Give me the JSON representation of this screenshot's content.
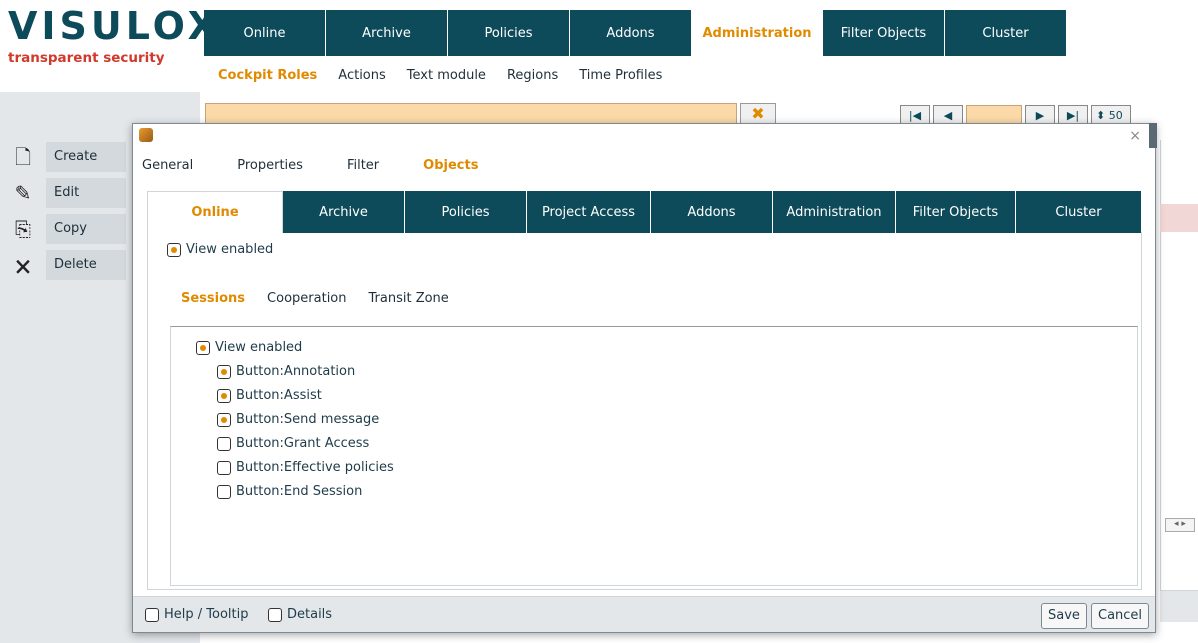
{
  "app": {
    "logo_main": "VISULOX",
    "logo_sub": "transparent security"
  },
  "topnav": [
    "Online",
    "Archive",
    "Policies",
    "Addons",
    "Administration",
    "Filter Objects",
    "Cluster"
  ],
  "topnav_active": "Administration",
  "subnav": [
    "Cockpit Roles",
    "Actions",
    "Text module",
    "Regions",
    "Time Profiles"
  ],
  "subnav_active": "Cockpit Roles",
  "pager": {
    "page_size": "50"
  },
  "side_actions": [
    {
      "label": "Create",
      "icon": "new-document-icon"
    },
    {
      "label": "Edit",
      "icon": "edit-document-icon"
    },
    {
      "label": "Copy",
      "icon": "copy-document-icon"
    },
    {
      "label": "Delete",
      "icon": "delete-document-icon"
    }
  ],
  "dialog": {
    "close_glyph": "×",
    "tabs": [
      "General",
      "Properties",
      "Filter",
      "Objects"
    ],
    "tabs_active": "Objects",
    "object_tabs": [
      "Online",
      "Archive",
      "Policies",
      "Project Access",
      "Addons",
      "Administration",
      "Filter Objects",
      "Cluster"
    ],
    "object_tabs_active": "Online",
    "view_enabled": {
      "label": "View enabled",
      "checked": true
    },
    "subtabs": [
      "Sessions",
      "Cooperation",
      "Transit Zone"
    ],
    "subtabs_active": "Sessions",
    "tree": {
      "root": {
        "label": "View enabled",
        "checked": true
      },
      "items": [
        {
          "label": "Button:Annotation",
          "checked": true
        },
        {
          "label": "Button:Assist",
          "checked": true
        },
        {
          "label": "Button:Send message",
          "checked": true
        },
        {
          "label": "Button:Grant Access",
          "checked": false
        },
        {
          "label": "Button:Effective policies",
          "checked": false
        },
        {
          "label": "Button:End Session",
          "checked": false
        }
      ]
    },
    "footer": {
      "help_label": "Help / Tooltip",
      "details_label": "Details",
      "save_label": "Save",
      "cancel_label": "Cancel"
    }
  },
  "colors": {
    "brand_teal": "#0d4b5a",
    "accent_orange": "#e08a00",
    "logo_red": "#d0392b"
  }
}
